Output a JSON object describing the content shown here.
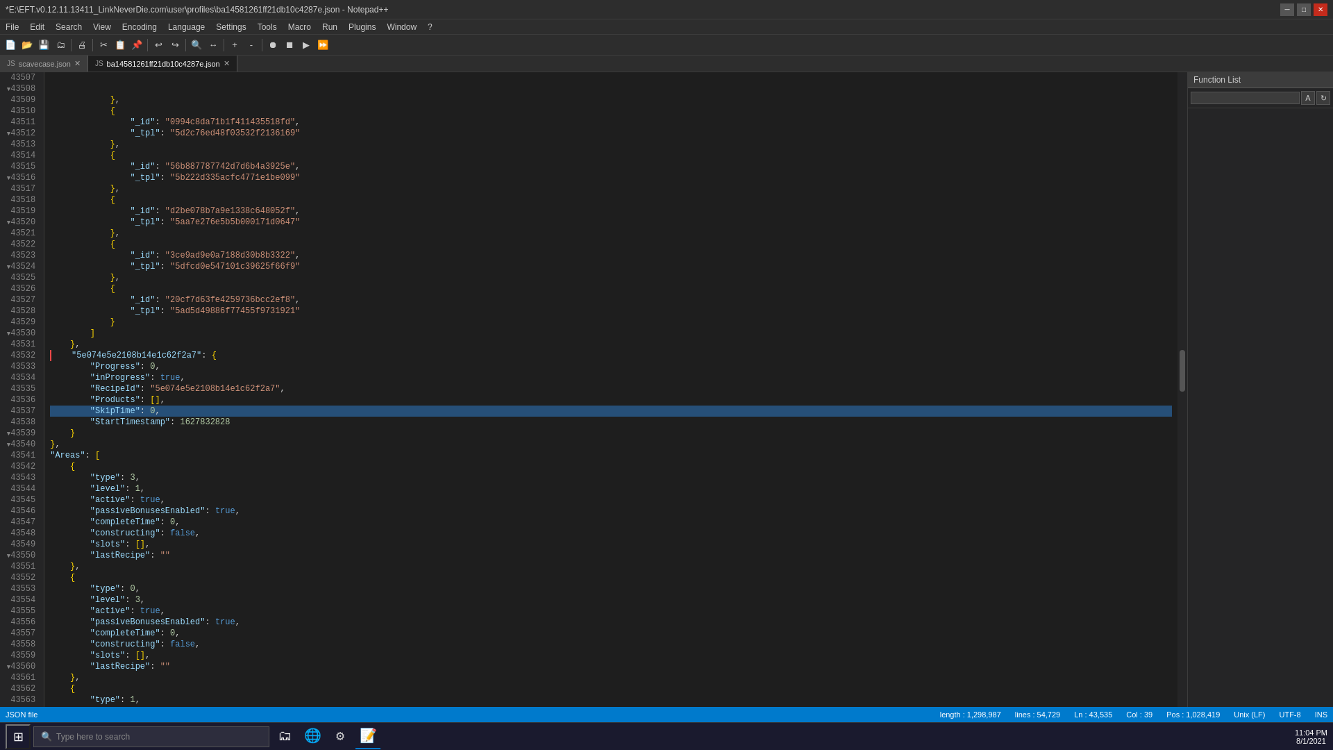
{
  "title": {
    "text": "*E:\\EFT.v0.12.11.13411_LinkNeverDie.com\\user\\profiles\\ba14581261ff21db10c4287e.json - Notepad++",
    "app": "Notepad++"
  },
  "menu": {
    "items": [
      "File",
      "Edit",
      "Search",
      "View",
      "Encoding",
      "Language",
      "Settings",
      "Tools",
      "Macro",
      "Run",
      "Plugins",
      "Window",
      "?"
    ]
  },
  "window_controls": {
    "minimize": "─",
    "maximize": "□",
    "close": "✕"
  },
  "tabs": [
    {
      "id": "tab1",
      "label": "scavecase.json",
      "active": false,
      "icon": "📄"
    },
    {
      "id": "tab2",
      "label": "ba14581261ff21db10c4287e.json",
      "active": true,
      "icon": "📄"
    }
  ],
  "function_list": {
    "title": "Function List",
    "search_placeholder": ""
  },
  "status_bar": {
    "file_type": "JSON file",
    "length": "length : 1,298,987",
    "lines": "lines : 54,729",
    "ln": "Ln : 43,535",
    "col": "Col : 39",
    "pos": "Pos : 1,028,419",
    "line_ending": "Unix (LF)",
    "encoding": "UTF-8",
    "ins": "INS"
  },
  "taskbar": {
    "search_placeholder": "Type here to search",
    "time": "11:04 PM",
    "date": "8/1/2021"
  },
  "code_lines": [
    {
      "num": "43507",
      "indent": 3,
      "content": "},"
    },
    {
      "num": "43508",
      "indent": 3,
      "content": "{",
      "fold": true
    },
    {
      "num": "43509",
      "indent": 4,
      "content": "\"_id\": \"0994c8da71b1f411435518fd\","
    },
    {
      "num": "43510",
      "indent": 4,
      "content": "\"_tpl\": \"5d2c76ed48f03532f2136169\""
    },
    {
      "num": "43511",
      "indent": 3,
      "content": "},"
    },
    {
      "num": "43512",
      "indent": 3,
      "content": "{",
      "fold": true
    },
    {
      "num": "43513",
      "indent": 4,
      "content": "\"_id\": \"56b887787742d7d6b4a3925e\","
    },
    {
      "num": "43514",
      "indent": 4,
      "content": "\"_tpl\": \"5b222d335acfc4771e1be099\""
    },
    {
      "num": "43515",
      "indent": 3,
      "content": "},"
    },
    {
      "num": "43516",
      "indent": 3,
      "content": "{",
      "fold": true
    },
    {
      "num": "43517",
      "indent": 4,
      "content": "\"_id\": \"d2be078b7a9e1338c648052f\","
    },
    {
      "num": "43518",
      "indent": 4,
      "content": "\"_tpl\": \"5aa7e276e5b5b000171d0647\""
    },
    {
      "num": "43519",
      "indent": 3,
      "content": "},"
    },
    {
      "num": "43520",
      "indent": 3,
      "content": "{",
      "fold": true
    },
    {
      "num": "43521",
      "indent": 4,
      "content": "\"_id\": \"3ce9ad9e0a7188d30b8b3322\","
    },
    {
      "num": "43522",
      "indent": 4,
      "content": "\"_tpl\": \"5dfcd0e547101c39625f66f9\""
    },
    {
      "num": "43523",
      "indent": 3,
      "content": "},"
    },
    {
      "num": "43524",
      "indent": 3,
      "content": "{",
      "fold": true
    },
    {
      "num": "43525",
      "indent": 4,
      "content": "\"_id\": \"20cf7d63fe4259736bcc2ef8\","
    },
    {
      "num": "43526",
      "indent": 4,
      "content": "\"_tpl\": \"5ad5d49886f77455f9731921\""
    },
    {
      "num": "43527",
      "indent": 3,
      "content": "}"
    },
    {
      "num": "43528",
      "indent": 2,
      "content": "]"
    },
    {
      "num": "43529",
      "indent": 1,
      "content": "},"
    },
    {
      "num": "43530",
      "indent": 1,
      "content": "\"5e074e5e2108b14e1c62f2a7\": {",
      "fold": true,
      "error": true
    },
    {
      "num": "43531",
      "indent": 2,
      "content": "\"Progress\": 0,"
    },
    {
      "num": "43532",
      "indent": 2,
      "content": "\"inProgress\": true,"
    },
    {
      "num": "43533",
      "indent": 2,
      "content": "\"RecipeId\": \"5e074e5e2108b14e1c62f2a7\","
    },
    {
      "num": "43534",
      "indent": 2,
      "content": "\"Products\": [],"
    },
    {
      "num": "43535",
      "indent": 2,
      "content": "\"SkipTime\": 0,",
      "selected": true
    },
    {
      "num": "43536",
      "indent": 2,
      "content": "\"StartTimestamp\": 1627832828"
    },
    {
      "num": "43537",
      "indent": 1,
      "content": "}"
    },
    {
      "num": "43538",
      "indent": 0,
      "content": "},"
    },
    {
      "num": "43539",
      "indent": 0,
      "content": "\"Areas\": [",
      "fold": true
    },
    {
      "num": "43540",
      "indent": 1,
      "content": "{",
      "fold": true
    },
    {
      "num": "43541",
      "indent": 2,
      "content": "\"type\": 3,"
    },
    {
      "num": "43542",
      "indent": 2,
      "content": "\"level\": 1,"
    },
    {
      "num": "43543",
      "indent": 2,
      "content": "\"active\": true,"
    },
    {
      "num": "43544",
      "indent": 2,
      "content": "\"passiveBonusesEnabled\": true,"
    },
    {
      "num": "43545",
      "indent": 2,
      "content": "\"completeTime\": 0,"
    },
    {
      "num": "43546",
      "indent": 2,
      "content": "\"constructing\": false,"
    },
    {
      "num": "43547",
      "indent": 2,
      "content": "\"slots\": [],"
    },
    {
      "num": "43548",
      "indent": 2,
      "content": "\"lastRecipe\": \"\""
    },
    {
      "num": "43549",
      "indent": 1,
      "content": "},"
    },
    {
      "num": "43550",
      "indent": 1,
      "content": "{",
      "fold": true
    },
    {
      "num": "43551",
      "indent": 2,
      "content": "\"type\": 0,"
    },
    {
      "num": "43552",
      "indent": 2,
      "content": "\"level\": 3,"
    },
    {
      "num": "43553",
      "indent": 2,
      "content": "\"active\": true,"
    },
    {
      "num": "43554",
      "indent": 2,
      "content": "\"passiveBonusesEnabled\": true,"
    },
    {
      "num": "43555",
      "indent": 2,
      "content": "\"completeTime\": 0,"
    },
    {
      "num": "43556",
      "indent": 2,
      "content": "\"constructing\": false,"
    },
    {
      "num": "43557",
      "indent": 2,
      "content": "\"slots\": [],"
    },
    {
      "num": "43558",
      "indent": 2,
      "content": "\"lastRecipe\": \"\""
    },
    {
      "num": "43559",
      "indent": 1,
      "content": "},"
    },
    {
      "num": "43560",
      "indent": 1,
      "content": "{",
      "fold": true
    },
    {
      "num": "43561",
      "indent": 2,
      "content": "\"type\": 1,"
    },
    {
      "num": "43562",
      "indent": 2,
      "content": "\"level\": 3,"
    },
    {
      "num": "43563",
      "indent": 2,
      "content": "\"active\": true,"
    }
  ]
}
